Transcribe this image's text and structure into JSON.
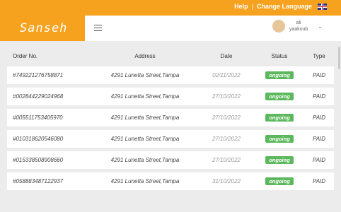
{
  "topbar": {
    "help": "Help",
    "separator": "|",
    "change_language": "Change Language",
    "flag_icon": "uk-flag-icon"
  },
  "logo": {
    "text": "Sanseh"
  },
  "header": {
    "menu_icon": "hamburger-icon",
    "user": {
      "name_line1": "ali",
      "name_line2": "yaakoub"
    },
    "chevron_icon": "chevron-down-icon"
  },
  "table": {
    "headers": {
      "order": "Order No.",
      "address": "Address",
      "date": "Date",
      "status": "Status",
      "type": "Type"
    },
    "rows": [
      {
        "order": "#749221276758871",
        "address": "4291 Lunetta Street,Tampa",
        "date": "02/11/2022",
        "status": "ongoing",
        "type": "PAID"
      },
      {
        "order": "#002844229024968",
        "address": "4291 Lunetta Street,Tampa",
        "date": "27/10/2022",
        "status": "ongoing",
        "type": "PAID"
      },
      {
        "order": "#005511753405970",
        "address": "4291 Lunetta Street,Tampa",
        "date": "27/10/2022",
        "status": "ongoing",
        "type": "PAID"
      },
      {
        "order": "#010318620546080",
        "address": "4291 Lunetta Street,Tampa",
        "date": "27/10/2022",
        "status": "ongoing",
        "type": "PAID"
      },
      {
        "order": "#015338508908660",
        "address": "4291 Lunetta Street,Tampa",
        "date": "27/10/2022",
        "status": "ongoing",
        "type": "PAID"
      },
      {
        "order": "#058883487122937",
        "address": "4291 Lunetta Street,Tampa",
        "date": "31/10/2022",
        "status": "ongoing",
        "type": "PAID"
      }
    ]
  },
  "colors": {
    "brand": "#f7a21f",
    "status_ongoing": "#5cb85c",
    "background": "#ececec"
  }
}
